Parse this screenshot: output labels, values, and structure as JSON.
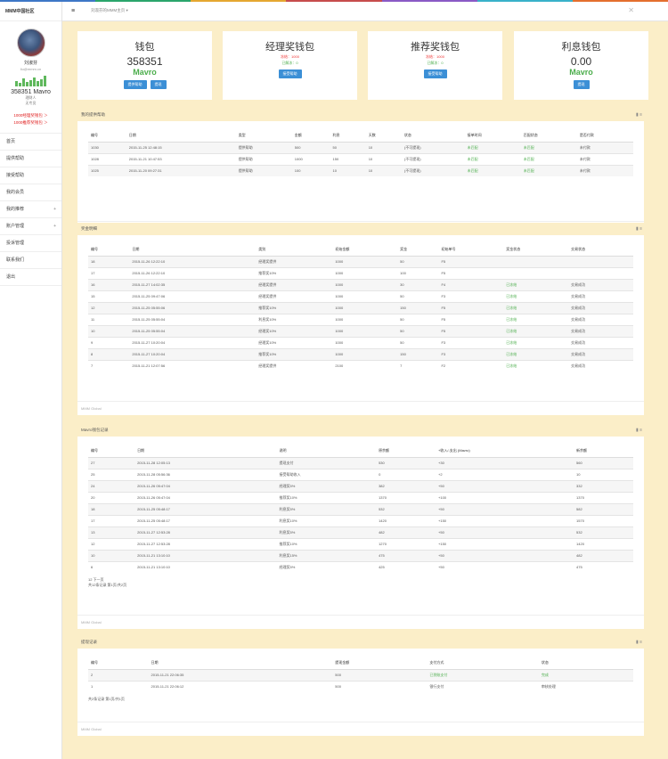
{
  "colors": {
    "stripe": [
      "#3e77c6",
      "#2aa56c",
      "#e5a730",
      "#c64c4c",
      "#8a5ac5",
      "#39b1c9",
      "#e46f2e"
    ],
    "accent": "#3b8fd6",
    "mavro": "#4cae4c",
    "bg": "#fbeec8"
  },
  "brand": "MMM中国社区",
  "profile": {
    "name": "刘淑芬",
    "email": "liu@mmm.cn",
    "balance": "358351 Mavro",
    "line1": "理财人",
    "line2": "无专员",
    "warn1": "1000经理奖钱包 ＞",
    "warn2": "1000推荐奖钱包 ＞"
  },
  "activity_bars": [
    6,
    4,
    9,
    5,
    7,
    10,
    6,
    8,
    12
  ],
  "menu": [
    {
      "label": "首页"
    },
    {
      "label": "提供帮助"
    },
    {
      "label": "接受帮助"
    },
    {
      "label": "我的会员"
    },
    {
      "label": "我的推荐",
      "arrow": "+"
    },
    {
      "label": "账户管理",
      "arrow": "+"
    },
    {
      "label": "投诉管理"
    },
    {
      "label": "联系我们"
    },
    {
      "label": "退出"
    }
  ],
  "topbar": {
    "menu_icon": "≡",
    "breadcrumb": "刘淑芬的MMM主页 ▾",
    "expand_icon": "✕"
  },
  "cards": [
    {
      "title": "钱包",
      "value": "358351",
      "unit": "Mavro",
      "buttons": [
        "提供帮助",
        "提现"
      ]
    },
    {
      "title": "经理奖钱包",
      "red": "冻结：1000",
      "green": "已解冻：0",
      "buttons": [
        "接受帮助"
      ]
    },
    {
      "title": "推荐奖钱包",
      "red": "冻结：1000",
      "green": "已解冻：0",
      "buttons": [
        "接受帮助"
      ]
    },
    {
      "title": "利息钱包",
      "value": "0.00",
      "unit": "Mavro",
      "buttons": [
        "提现"
      ]
    }
  ],
  "panel1": {
    "title": "我的提供帮助",
    "columns": [
      "编号",
      "日期",
      "类型",
      "金额",
      "利息",
      "天数",
      "状态",
      "接单时间",
      "匹配状态",
      "是否付款"
    ],
    "rows": [
      [
        "1030",
        "2015-11-25 12:48:15",
        "提供帮助",
        "500",
        "50",
        "10",
        "(不可提现)",
        "未匹配",
        "未匹配",
        "未付款"
      ],
      [
        "1028",
        "2015-11-21 10:47:53",
        "提供帮助",
        "1000",
        "150",
        "10",
        "(不可提现)",
        "未匹配",
        "未匹配",
        "未付款"
      ],
      [
        "1025",
        "2015-11-20 09:27:31",
        "提供帮助",
        "100",
        "10",
        "10",
        "(不可提现)",
        "未匹配",
        "未匹配",
        "未付款"
      ]
    ],
    "footer": "MMM Global"
  },
  "panel2": {
    "title": "奖金明细",
    "columns": [
      "编号",
      "日期",
      "类别",
      "初始金额",
      "奖金",
      "初始单号",
      "奖金状态",
      "交易状态"
    ],
    "rows": [
      [
        "18",
        "2015-11-26 12:22:10",
        "经理奖提供",
        "1000",
        "50",
        "F5",
        "",
        ""
      ],
      [
        "17",
        "2015-11-26 12:22:10",
        "推荐奖10%",
        "1000",
        "100",
        "F5",
        "",
        ""
      ],
      [
        "16",
        "2015-11-27 14:02:35",
        "经理奖提供",
        "1000",
        "30",
        "F4",
        "已冻结",
        "交易成功"
      ],
      [
        "15",
        "2015-11-25 09:47:06",
        "经理奖提供",
        "1000",
        "50",
        "F3",
        "已冻结",
        "交易成功"
      ],
      [
        "12",
        "2015-11-25 05:55:06",
        "推荐奖10%",
        "1000",
        "150",
        "F5",
        "已冻结",
        "交易成功"
      ],
      [
        "11",
        "2015-11-25 05:55:04",
        "利息奖10%",
        "1000",
        "50",
        "F5",
        "已冻结",
        "交易成功"
      ],
      [
        "10",
        "2015-11-25 05:55:04",
        "经理奖10%",
        "1000",
        "50",
        "F5",
        "已冻结",
        "交易成功"
      ],
      [
        "9",
        "2015-11-27 10:20:04",
        "经理奖10%",
        "1000",
        "50",
        "F3",
        "已冻结",
        "交易成功"
      ],
      [
        "8",
        "2015-11-27 10:20:04",
        "推荐奖10%",
        "1000",
        "150",
        "F3",
        "已冻结",
        "交易成功"
      ],
      [
        "7",
        "2015-11-21 12:07:56",
        "经理奖提供",
        "2100",
        "7",
        "F2",
        "已冻结",
        "交易成功"
      ]
    ],
    "footer": "MMM Global"
  },
  "panel3": {
    "title": "Mavro钱包记录",
    "columns": [
      "编号",
      "日期",
      "说明",
      "原余额",
      "+收入/-支出 (Mavro)",
      "新余额"
    ],
    "rows": [
      [
        "27",
        "2015-11-28 12:05:13",
        "提现支付",
        "530",
        "+30",
        "560"
      ],
      [
        "25",
        "2015-11-28 05:56:36",
        "接受帮助收入",
        "0",
        "+2",
        "10"
      ],
      [
        "24",
        "2015-11-26 05:47:04",
        "经理奖5%",
        "382",
        "+50",
        "332"
      ],
      [
        "20",
        "2015-11-26 05:47:04",
        "推荐奖10%",
        "1370",
        "+100",
        "1370"
      ],
      [
        "18",
        "2015-11-25 05:48:17",
        "利息奖5%",
        "532",
        "+50",
        "582"
      ],
      [
        "17",
        "2015-11-25 05:48:17",
        "利息奖10%",
        "1420",
        "+150",
        "1570"
      ],
      [
        "13",
        "2015-11-27 12:53:28",
        "利息奖5%",
        "482",
        "+50",
        "532"
      ],
      [
        "12",
        "2015-11-27 12:53:28",
        "推荐奖10%",
        "1270",
        "+150",
        "1420"
      ],
      [
        "10",
        "2015-11-21 13:10:10",
        "利息奖15%",
        "475",
        "+50",
        "482"
      ],
      [
        "6",
        "2015-11-21 13:10:10",
        "经理奖5%",
        "425",
        "+50",
        "475"
      ]
    ],
    "pagination1": "12 下一页",
    "pagination2": "共12条记录 第1页/共2页",
    "footer": "MMM Global"
  },
  "panel4": {
    "title": "提现记录",
    "columns": [
      "编号",
      "日期",
      "提现金额",
      "支付方式",
      "状态"
    ],
    "rows": [
      [
        "2",
        "2015-11-21 22:06:35",
        "500",
        "已到账支付",
        "完成"
      ],
      [
        "1",
        "2015-11-21 22:06:12",
        "500",
        "银行支付",
        "审核处理"
      ]
    ],
    "summary": "共2条记录 第1页/共1页",
    "footer": "MMM Global"
  }
}
